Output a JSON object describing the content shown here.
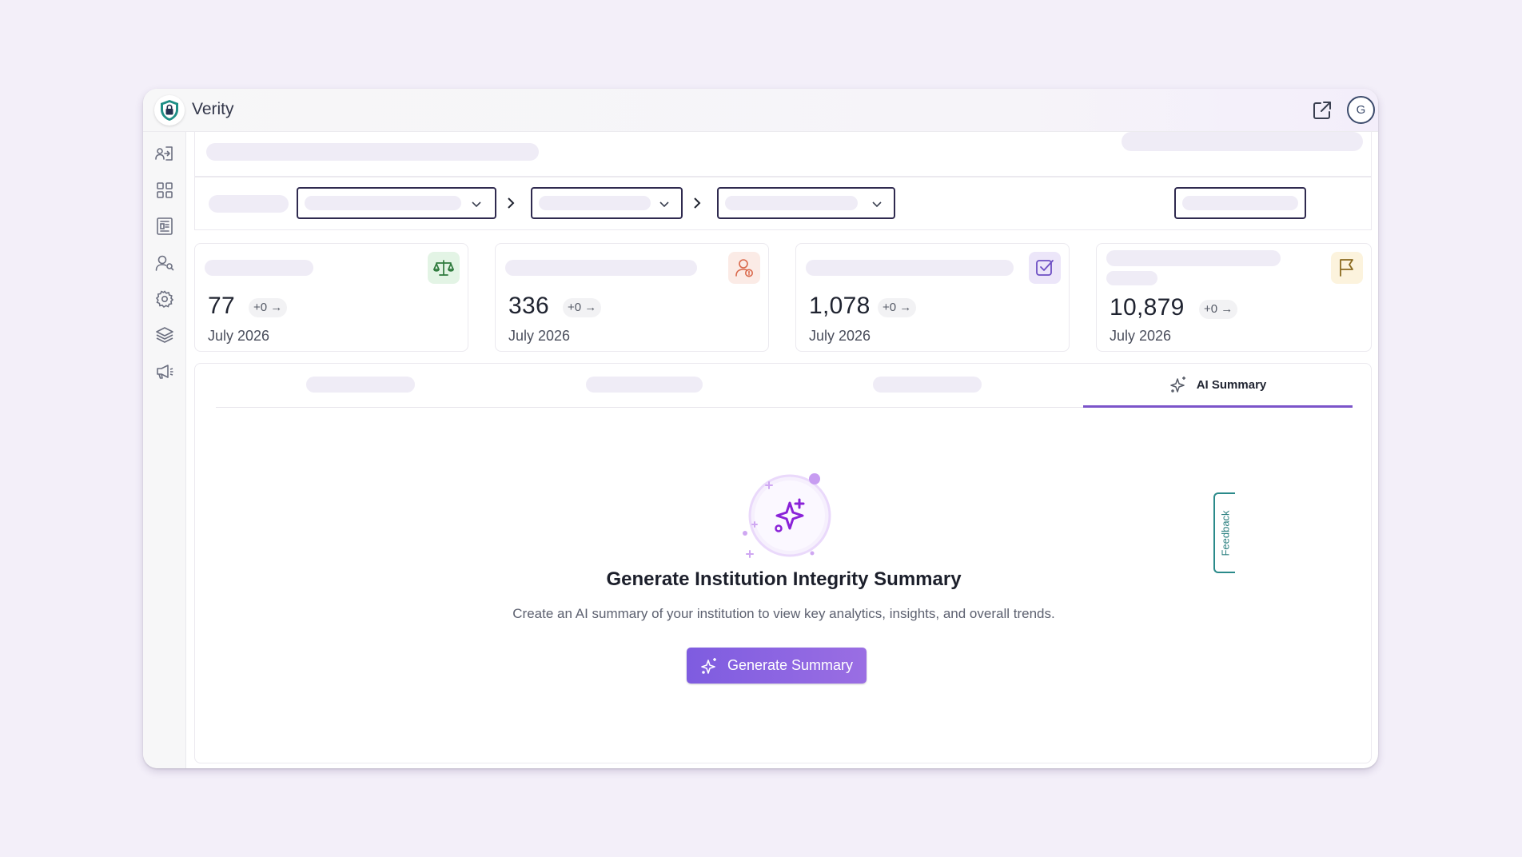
{
  "app": {
    "title": "Verity",
    "avatar_initial": "G"
  },
  "colors": {
    "accent": "#7b54c9",
    "button": "#8b63e0",
    "feedback": "#2a8a8a"
  },
  "sidebar": {
    "items": [
      {
        "icon": "login-icon"
      },
      {
        "icon": "dashboard-grid-icon"
      },
      {
        "icon": "report-icon"
      },
      {
        "icon": "user-search-icon"
      },
      {
        "icon": "settings-gear-icon"
      },
      {
        "icon": "layers-icon"
      },
      {
        "icon": "announcement-icon"
      }
    ]
  },
  "cards": [
    {
      "icon": "scales-icon",
      "value": "77",
      "delta": "+0",
      "period": "July 2026"
    },
    {
      "icon": "user-alert-icon",
      "value": "336",
      "delta": "+0",
      "period": "July 2026"
    },
    {
      "icon": "checkbox-icon",
      "value": "1,078",
      "delta": "+0",
      "period": "July 2026"
    },
    {
      "icon": "flag-icon",
      "value": "10,879",
      "delta": "+0",
      "period": "July 2026"
    }
  ],
  "tabs": {
    "active_label": "AI Summary"
  },
  "summary": {
    "title": "Generate Institution Integrity Summary",
    "description": "Create an AI summary of your institution to view key analytics, insights, and overall trends.",
    "button_label": "Generate Summary"
  },
  "feedback_label": "Feedback"
}
